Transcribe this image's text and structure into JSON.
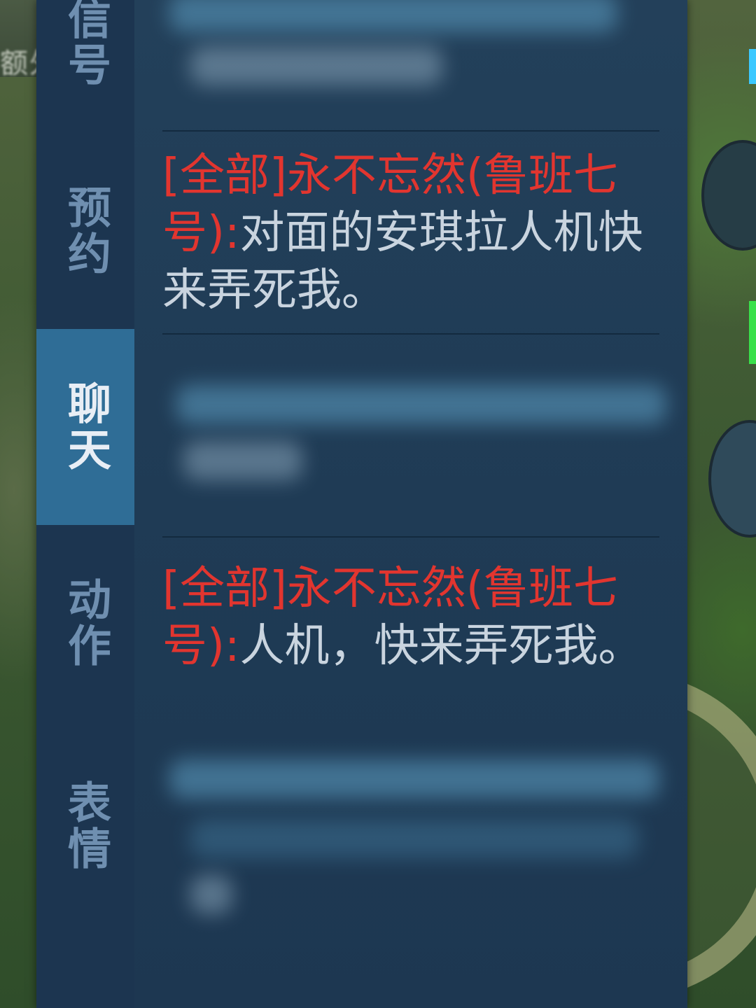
{
  "background": {
    "map_text": "额外"
  },
  "tabs": [
    {
      "id": "signal",
      "label": "信号",
      "active": false
    },
    {
      "id": "reserve",
      "label": "预约",
      "active": false
    },
    {
      "id": "chat",
      "label": "聊天",
      "active": true
    },
    {
      "id": "action",
      "label": "动作",
      "active": false
    },
    {
      "id": "emote",
      "label": "表情",
      "active": false
    }
  ],
  "messages": [
    {
      "channel": "[全部]",
      "sender": "永不忘然(鲁班七号)",
      "separator": ":",
      "text": "对面的安琪拉人机快来弄死我。"
    },
    {
      "channel": "[全部]",
      "sender": "永不忘然(鲁班七号)",
      "separator": ":",
      "text": "人机，快来弄死我。"
    }
  ],
  "colors": {
    "panel_bg": "#1f3b55",
    "tab_active_bg": "#2f6d96",
    "sender_red": "#e2352f",
    "message_text": "#c9d4df",
    "tab_inactive_text": "#6f8fb0"
  }
}
